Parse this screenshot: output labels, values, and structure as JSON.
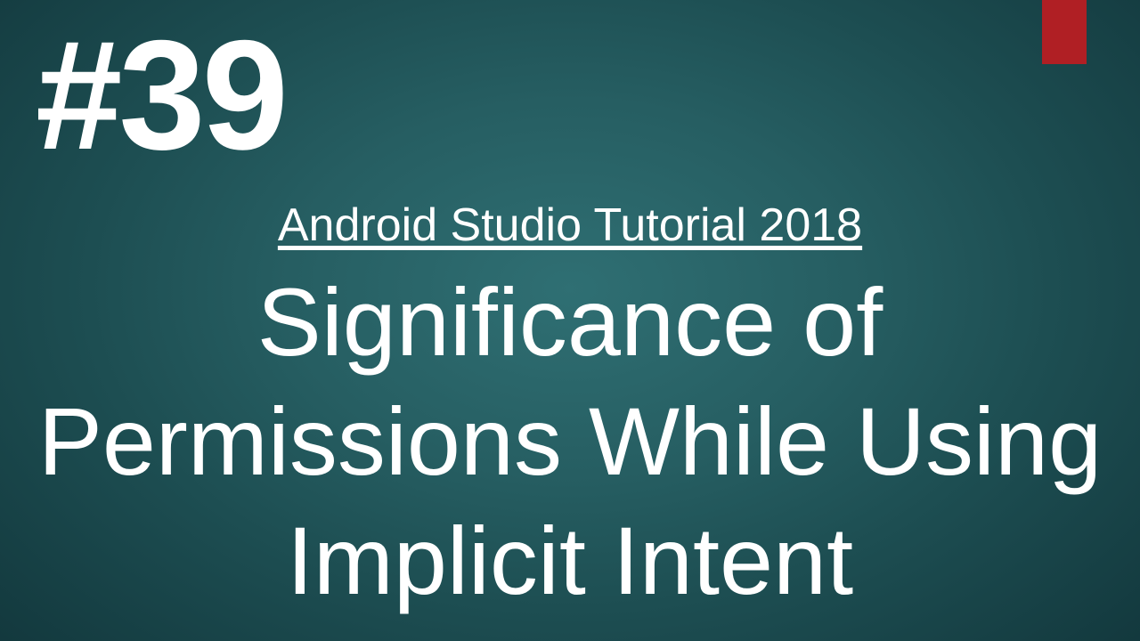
{
  "episode_number": "#39",
  "subtitle": "Android  Studio Tutorial 2018",
  "title": "Significance of Permissions While Using Implicit Intent"
}
